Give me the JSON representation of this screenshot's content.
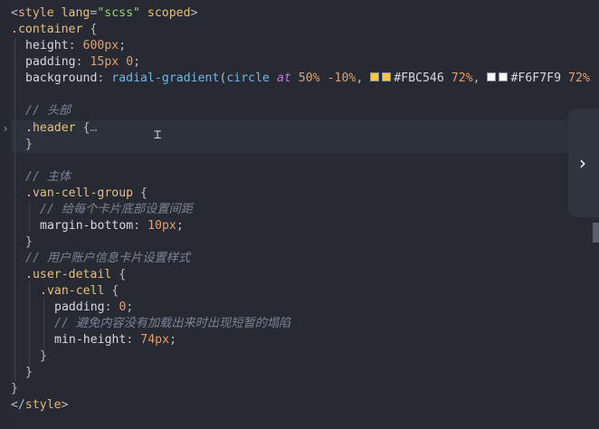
{
  "code": {
    "line1": {
      "open": "<",
      "tag": "style",
      "space": " ",
      "attr1": "lang",
      "eq1": "=",
      "val1": "\"scss\"",
      "space2": " ",
      "attr2": "scoped",
      "close": ">"
    },
    "line2": {
      "sel": ".container",
      "brace": " {"
    },
    "line3": {
      "prop": "height",
      "colon": ": ",
      "num": "600px",
      "semi": ";"
    },
    "line4": {
      "prop": "padding",
      "colon": ": ",
      "num1": "15px",
      "space": " ",
      "num2": "0",
      "semi": ";"
    },
    "line5": {
      "prop": "background",
      "colon": ": ",
      "fn": "radial-gradient",
      "paren": "(",
      "kw1": "circle",
      "sp1": " ",
      "kw2": "at",
      "sp2": " ",
      "num1": "50%",
      "sp3": " ",
      "num2": "-10%",
      "comma1": ", ",
      "color1": "#FBC546",
      "sp4": " ",
      "num3": "72%",
      "comma2": ", ",
      "color2": "#F6F7F9",
      "sp5": " ",
      "num4": "72%"
    },
    "line7": {
      "comment": "// 头部"
    },
    "line8": {
      "sel": ".header",
      "brace": " {",
      "fold": "…"
    },
    "line9": {
      "brace": "}"
    },
    "line11": {
      "comment": "// 主体"
    },
    "line12": {
      "sel": ".van-cell-group",
      "brace": " {"
    },
    "line13": {
      "comment": "// 给每个卡片底部设置间距"
    },
    "line14": {
      "prop": "margin-bottom",
      "colon": ": ",
      "num": "10px",
      "semi": ";"
    },
    "line15": {
      "brace": "}"
    },
    "line16": {
      "comment": "// 用户账户信息卡片设置样式"
    },
    "line17": {
      "sel": ".user-detail",
      "brace": " {"
    },
    "line18": {
      "sel": ".van-cell",
      "brace": " {"
    },
    "line19": {
      "prop": "padding",
      "colon": ": ",
      "num": "0",
      "semi": ";"
    },
    "line20": {
      "comment": "// 避免内容没有加载出来时出现短暂的塌陷"
    },
    "line21": {
      "prop": "min-height",
      "colon": ": ",
      "num": "74px",
      "semi": ";"
    },
    "line22": {
      "brace": "}"
    },
    "line23": {
      "brace": "}"
    },
    "line24": {
      "brace": "}"
    },
    "line25": {
      "open": "</",
      "tag": "style",
      "close": ">"
    }
  },
  "swatches": {
    "color1": "#FBC546",
    "color2": "#F6F7F9"
  },
  "icons": {
    "fold": "chevron-right-icon",
    "panel": "chevron-right-icon",
    "cursor": "text-cursor-icon"
  },
  "theme": {
    "background": "#272a33"
  }
}
